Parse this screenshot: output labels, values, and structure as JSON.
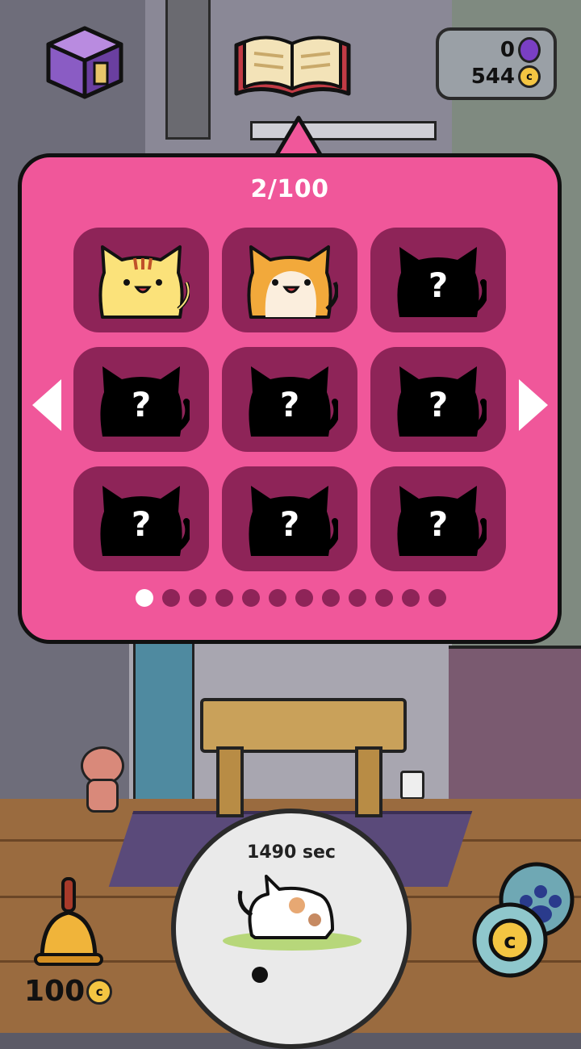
{
  "hud": {
    "gems": "0",
    "coins": "544",
    "coin_glyph": "c"
  },
  "catalog": {
    "count": "2/100",
    "page_current": 1,
    "page_total": 12,
    "cells": [
      {
        "state": "discovered",
        "cat": "yellow-striped-cat"
      },
      {
        "state": "discovered",
        "cat": "orange-white-cat"
      },
      {
        "state": "unknown",
        "mark": "?"
      },
      {
        "state": "unknown",
        "mark": "?"
      },
      {
        "state": "unknown",
        "mark": "?"
      },
      {
        "state": "unknown",
        "mark": "?"
      },
      {
        "state": "unknown",
        "mark": "?"
      },
      {
        "state": "unknown",
        "mark": "?"
      },
      {
        "state": "unknown",
        "mark": "?"
      }
    ]
  },
  "bell": {
    "price": "100",
    "coin_glyph": "c"
  },
  "timer": {
    "text": "1490 sec"
  },
  "shop": {
    "coin_glyph": "c"
  },
  "colors": {
    "popup": "#f0579a",
    "cell": "#8e2458",
    "gem": "#7a3fc4",
    "coin": "#f4c542"
  }
}
